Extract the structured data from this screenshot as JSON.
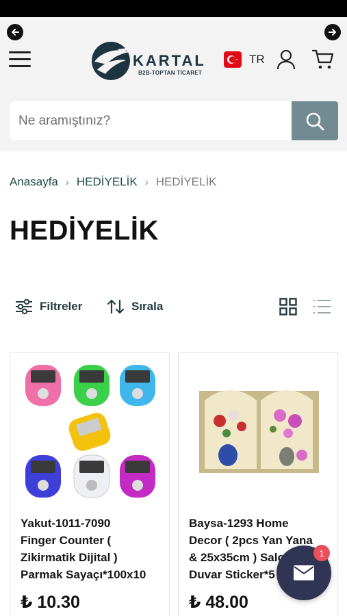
{
  "header": {
    "logo_text": "KARTAL",
    "logo_sub": "B2B-TOPTAN TİCARET",
    "language": "TR",
    "icons": [
      "back-arrow-icon",
      "forward-arrow-icon",
      "hamburger-menu-icon",
      "turkey-flag-icon",
      "user-icon",
      "cart-icon"
    ]
  },
  "search": {
    "placeholder": "Ne aramıştınız?",
    "icon": "search-icon"
  },
  "breadcrumb": {
    "items": [
      "Anasayfa",
      "HEDİYELİK",
      "HEDİYELİK"
    ],
    "separator": "›"
  },
  "page_title": "HEDİYELİK",
  "toolbar": {
    "filter_label": "Filtreler",
    "sort_label": "Sırala"
  },
  "products": [
    {
      "title": "Yakut-1011-7090\nFinger Counter (\nZikirmatik Dijital )\nParmak Sayaçı*100x10",
      "price": "₺ 10.30"
    },
    {
      "title": "Baysa-1293 Home\nDecor ( 2pcs Yan Yana\n& 25x35cm ) Salon\nDuvar Sticker*5",
      "price": "₺ 48.00"
    }
  ],
  "chat": {
    "badge": "1"
  },
  "colors": {
    "search_button": "#728a91",
    "brand": "#1f3441",
    "chat": "#2f3553",
    "badge": "#e9505a"
  }
}
